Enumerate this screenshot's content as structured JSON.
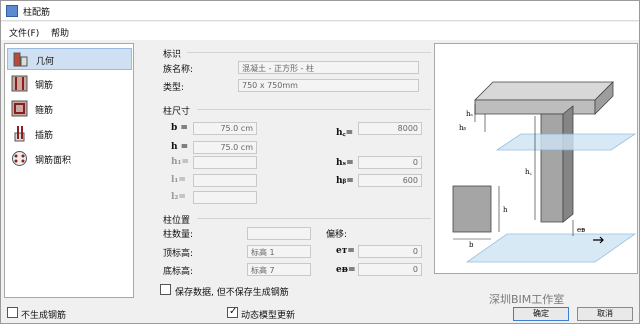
{
  "window": {
    "title": "柱配筋"
  },
  "menu": [
    "文件(F)",
    "帮助"
  ],
  "nav": [
    {
      "label": "几何",
      "icon": "geometry-icon"
    },
    {
      "label": "钢筋",
      "icon": "rebar-icon"
    },
    {
      "label": "箍筋",
      "icon": "stirrup-icon"
    },
    {
      "label": "插筋",
      "icon": "dowel-icon"
    },
    {
      "label": "钢筋面积",
      "icon": "rebar-area-icon"
    }
  ],
  "identity": {
    "title": "标识",
    "name_label": "族名称:",
    "name_value": "混凝土 - 正方形 - 柱",
    "type_label": "类型:",
    "type_value": "750 x 750mm"
  },
  "dims": {
    "title": "柱尺寸",
    "b_label": "b =",
    "b_value": "75.0 cm",
    "h_label": "h =",
    "h_value": "75.0 cm",
    "h1_label": "h₁=",
    "l1_label": "l₁=",
    "l2_label": "l₂=",
    "hc_label": "h꜀=",
    "hc_value": "8000",
    "hs_label": "hₛ=",
    "hs_value": "0",
    "hb_label": "hᵦ=",
    "hb_value": "600"
  },
  "position": {
    "title": "柱位置",
    "count_label": "柱数量:",
    "top_label": "顶标高:",
    "top_value": "标高 1",
    "base_label": "底标高:",
    "base_value": "标高 7",
    "offset_title": "偏移:",
    "eT_label": "eᴛ=",
    "eT_value": "0",
    "eB_label": "eᴃ=",
    "eB_value": "0"
  },
  "save_only": "保存数据, 但不保存生成钢筋",
  "no_rebar": "不生成钢筋",
  "dynamic_update": "动态模型更新",
  "buttons": {
    "ok": "确定",
    "cancel": "取消"
  },
  "watermark": "深圳BIM工作室",
  "diagram": {
    "b": "b",
    "h": "h",
    "hc": "h꜀",
    "hs": "hₛ",
    "hb": "hᵦ",
    "eB": "eᴃ"
  }
}
